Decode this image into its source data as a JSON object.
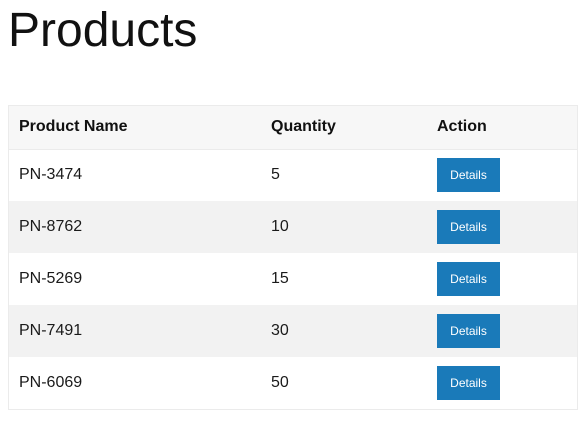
{
  "page": {
    "title": "Products"
  },
  "table": {
    "headers": {
      "name": "Product Name",
      "quantity": "Quantity",
      "action": "Action"
    },
    "rows": [
      {
        "name": "PN-3474",
        "quantity": "5",
        "action": "Details"
      },
      {
        "name": "PN-8762",
        "quantity": "10",
        "action": "Details"
      },
      {
        "name": "PN-5269",
        "quantity": "15",
        "action": "Details"
      },
      {
        "name": "PN-7491",
        "quantity": "30",
        "action": "Details"
      },
      {
        "name": "PN-6069",
        "quantity": "50",
        "action": "Details"
      }
    ]
  },
  "colors": {
    "button_bg": "#1a7ab9",
    "button_text": "#ffffff",
    "header_bg": "#f7f7f7",
    "stripe_bg": "#f2f2f2"
  }
}
